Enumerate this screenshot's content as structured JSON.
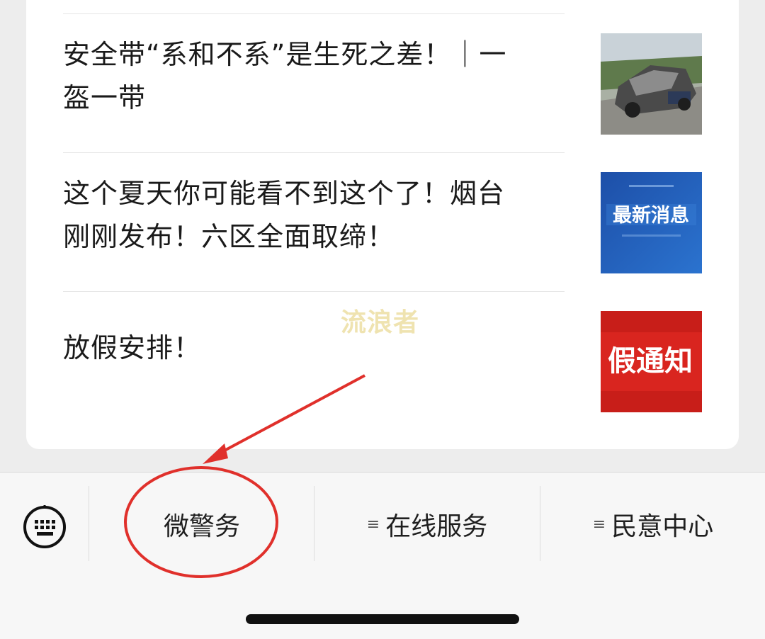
{
  "articles": [
    {
      "line1": "安全带“系和不系”是生死之差！｜一",
      "line2": "盔一带",
      "thumb_icon": "car-crash-photo"
    },
    {
      "line1": "这个夏天你可能看不到这个了！烟台",
      "line2": "刚刚发布！六区全面取缔！",
      "thumb_icon": "news-banner-image",
      "thumb_text": "最新消息"
    },
    {
      "line1": "放假安排！",
      "thumb_icon": "holiday-notice-image",
      "thumb_text": "假通知"
    }
  ],
  "watermark": "流浪者",
  "menu": {
    "keyboard_icon": "keyboard-icon",
    "items": [
      {
        "label": "微警务"
      },
      {
        "label": "在线服务",
        "prefix_glyph": "≡"
      },
      {
        "label": "民意中心",
        "prefix_glyph": "≡"
      }
    ]
  },
  "colors": {
    "annotation": "#e0302b",
    "card_bg": "#ffffff",
    "page_bg": "#ededed"
  }
}
